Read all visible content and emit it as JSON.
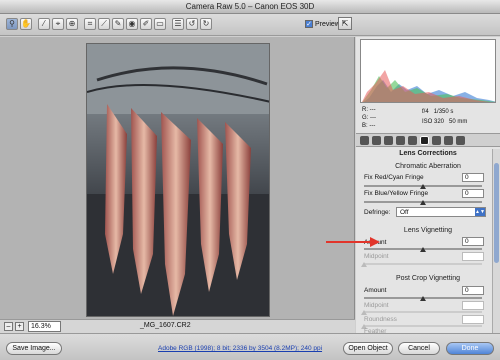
{
  "window": {
    "title": "Camera Raw 5.0  –  Canon EOS 30D"
  },
  "toolbar": {
    "tools": [
      "zoom-icon",
      "hand-icon",
      "white-balance-icon",
      "color-sampler-icon",
      "target-adjust-icon",
      "crop-icon",
      "straighten-icon",
      "spot-removal-icon",
      "red-eye-icon",
      "adjust-brush-icon",
      "graduated-filter-icon",
      "preferences-icon",
      "rotate-ccw-icon",
      "rotate-cw-icon"
    ],
    "preview_label": "Preview",
    "preview_checked": "✓"
  },
  "status": {
    "zoom_minus": "–",
    "zoom_plus": "+",
    "zoom_value": "16.3%",
    "filename": "_MG_1607.CR2"
  },
  "info": {
    "r": "R:",
    "g": "G:",
    "b": "B:",
    "dash": "---",
    "aperture": "f/4",
    "shutter": "1/350 s",
    "iso": "ISO 320",
    "focal": "50 mm"
  },
  "panel": {
    "title": "Lens Corrections",
    "chromatic": {
      "heading": "Chromatic Aberration",
      "fix_red_cyan": "Fix Red/Cyan Fringe",
      "fix_red_cyan_value": "0",
      "fix_blue_yellow": "Fix Blue/Yellow Fringe",
      "fix_blue_yellow_value": "0",
      "defringe_label": "Defringe:",
      "defringe_value": "Off"
    },
    "vignetting": {
      "heading": "Lens Vignetting",
      "amount_label": "Amount",
      "amount_value": "0",
      "midpoint_label": "Midpoint"
    },
    "post_crop": {
      "heading": "Post Crop Vignetting",
      "amount_label": "Amount",
      "amount_value": "0",
      "midpoint_label": "Midpoint",
      "roundness_label": "Roundness",
      "feather_label": "Feather"
    }
  },
  "bottom": {
    "save": "Save Image...",
    "workflow": "Adobe RGB (1998); 8 bit; 2336 by 3504 (8.2MP); 240 ppi",
    "open": "Open Object",
    "cancel": "Cancel",
    "done": "Done"
  },
  "colors": {
    "annotation_arrow": "#e2352b",
    "accent": "#4f84d7"
  }
}
